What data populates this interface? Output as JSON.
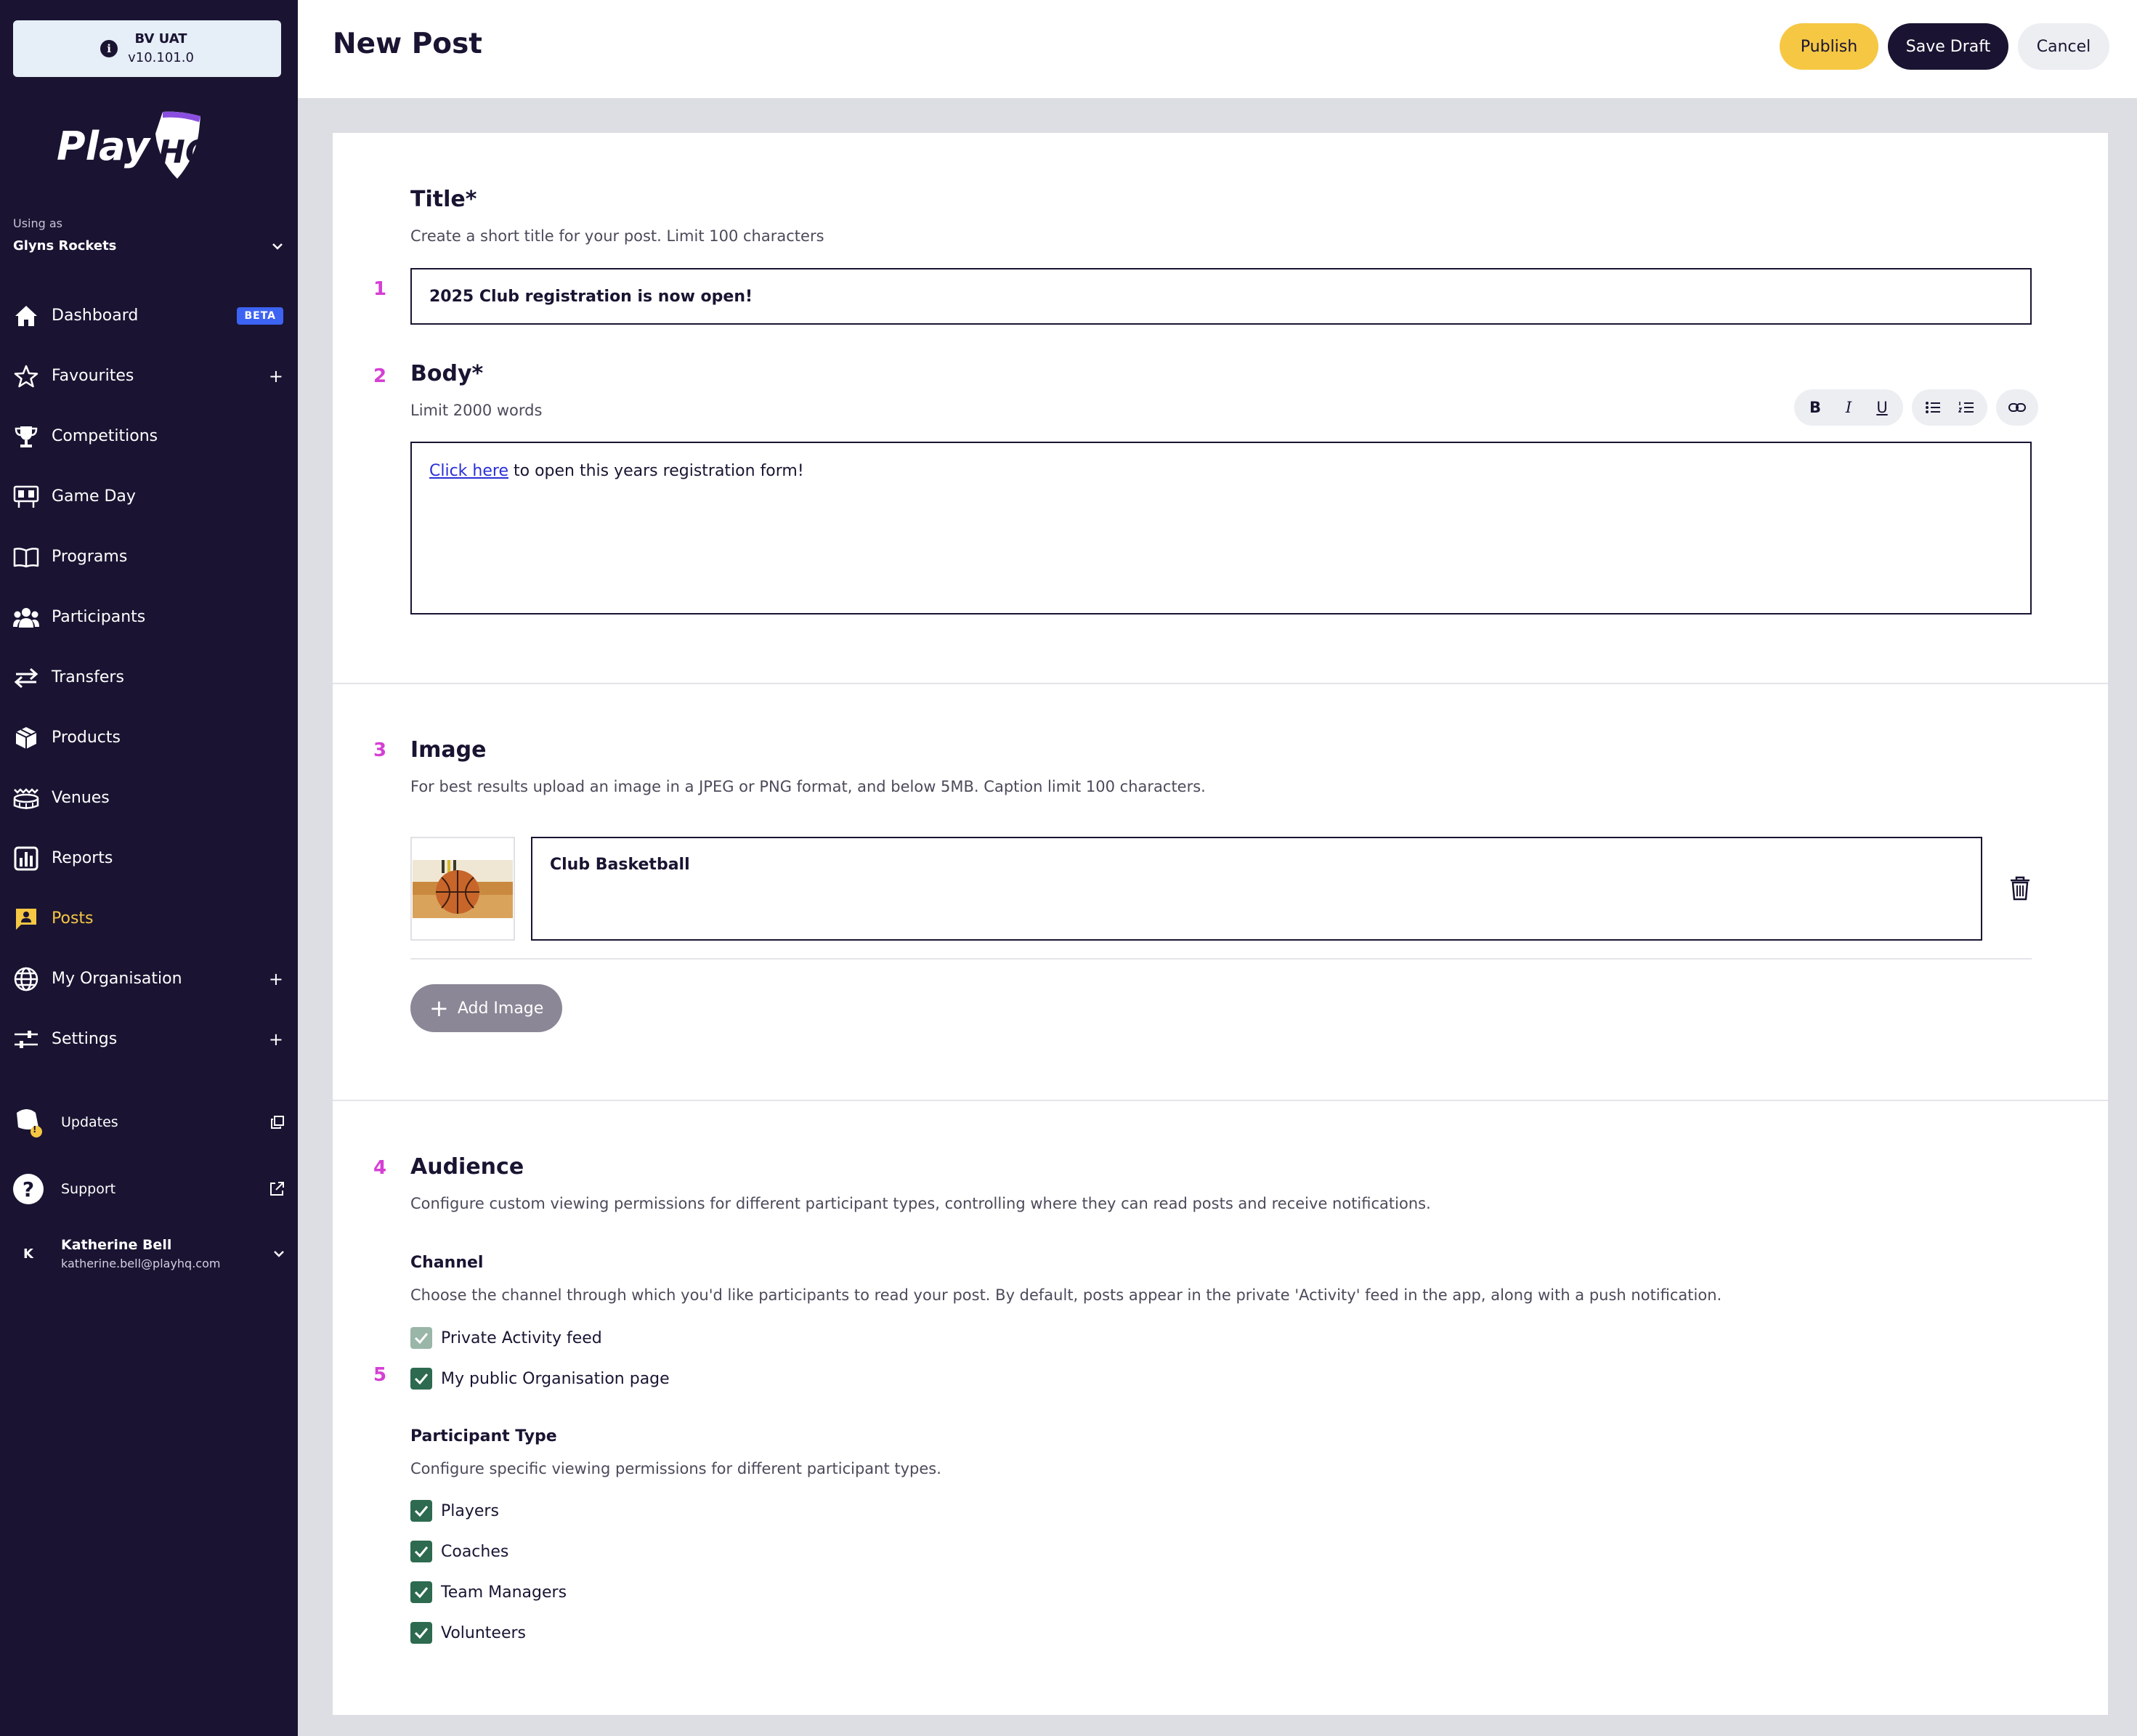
{
  "env": {
    "name": "BV UAT",
    "version": "v10.101.0",
    "info_glyph": "i"
  },
  "logo": {
    "text_play": "Play",
    "text_hq": "HQ"
  },
  "org": {
    "using_as_label": "Using as",
    "name": "Glyns Rockets"
  },
  "nav": {
    "items": [
      {
        "label": "Dashboard",
        "badge": "BETA",
        "icon": "home-icon"
      },
      {
        "label": "Favourites",
        "plus": "+",
        "icon": "star-icon"
      },
      {
        "label": "Competitions",
        "icon": "trophy-icon"
      },
      {
        "label": "Game Day",
        "icon": "scoreboard-icon"
      },
      {
        "label": "Programs",
        "icon": "book-icon"
      },
      {
        "label": "Participants",
        "icon": "people-icon"
      },
      {
        "label": "Transfers",
        "icon": "transfer-icon"
      },
      {
        "label": "Products",
        "icon": "box-icon"
      },
      {
        "label": "Venues",
        "icon": "stadium-icon"
      },
      {
        "label": "Reports",
        "icon": "chart-icon"
      },
      {
        "label": "Posts",
        "icon": "post-icon",
        "active": true
      },
      {
        "label": "My Organisation",
        "plus": "+",
        "icon": "globe-icon"
      },
      {
        "label": "Settings",
        "plus": "+",
        "icon": "sliders-icon"
      }
    ]
  },
  "utilities": {
    "updates": {
      "label": "Updates",
      "badge": "!"
    },
    "support": {
      "label": "Support",
      "glyph": "?"
    }
  },
  "user": {
    "initial": "K",
    "name": "Katherine Bell",
    "email": "katherine.bell@playhq.com"
  },
  "header": {
    "title": "New Post",
    "publish": "Publish",
    "save_draft": "Save Draft",
    "cancel": "Cancel"
  },
  "form": {
    "title": {
      "step": "1",
      "label": "Title*",
      "help": "Create a short title for your post. Limit 100 characters",
      "value": "2025 Club registration is now open!"
    },
    "body": {
      "step": "2",
      "label": "Body*",
      "help": "Limit 2000 words",
      "link_text": "Click here",
      "text": " to open this years registration form!",
      "toolbar": {
        "bold": "B",
        "italic": "I",
        "underline": "U"
      }
    },
    "image": {
      "step": "3",
      "label": "Image",
      "help": "For best results upload an image in a JPEG or PNG format, and below 5MB. Caption limit 100 characters.",
      "caption": "Club Basketball",
      "add_button": "Add Image",
      "add_glyph": "+"
    },
    "audience": {
      "step": "4",
      "label": "Audience",
      "help": "Configure custom viewing permissions for different participant types, controlling where they can read posts and receive notifications.",
      "channel_label": "Channel",
      "channel_help": "Choose the channel through which you'd like participants to read your post. By default, posts appear in the private 'Activity' feed in the app, along with a push notification.",
      "channel_step": "5",
      "channels": [
        {
          "label": "Private Activity feed",
          "checked": true,
          "disabled": true
        },
        {
          "label": "My public Organisation page",
          "checked": true,
          "disabled": false
        }
      ],
      "participant_label": "Participant Type",
      "participant_help": "Configure specific viewing permissions for different participant types.",
      "participants": [
        {
          "label": "Players",
          "checked": true
        },
        {
          "label": "Coaches",
          "checked": true
        },
        {
          "label": "Team Managers",
          "checked": true
        },
        {
          "label": "Volunteers",
          "checked": true
        }
      ]
    }
  },
  "colors": {
    "sidebar_bg": "#1a1432",
    "accent_yellow": "#f5c743",
    "step_magenta": "#d63fd4",
    "checkbox_green": "#2d6a4f",
    "beta_blue": "#3d63f2"
  }
}
